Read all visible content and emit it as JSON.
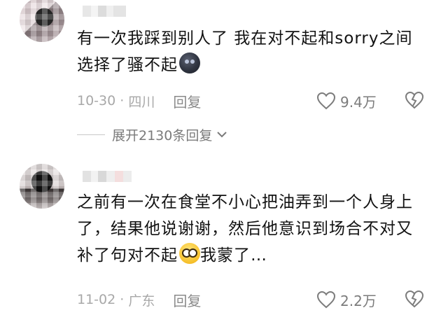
{
  "comments": [
    {
      "text": "有一次我踩到别人了 我在对不起和sorry之间选择了骚不起",
      "date": "10-30",
      "location": "四川",
      "reply_label": "回复",
      "likes": "9.4万",
      "emoji": "dark-face-emoji",
      "expand_label": "展开2130条回复"
    },
    {
      "text_before_emoji": "之前有一次在食堂不小心把油弄到一个人身上了，结果他说谢谢，然后他意识到场合不对又补了句对不起",
      "text_after_emoji": "我蒙了…",
      "date": "11-02",
      "location": "广东",
      "reply_label": "回复",
      "likes": "2.2万",
      "emoji": "wide-eyed-emoji"
    }
  ],
  "icons": {
    "like": "heart-outline-icon",
    "dislike": "broken-heart-icon",
    "expand": "chevron-down-icon"
  },
  "colors": {
    "text": "#121212",
    "meta": "#a8a8a8",
    "icon": "#7c7c7c"
  }
}
